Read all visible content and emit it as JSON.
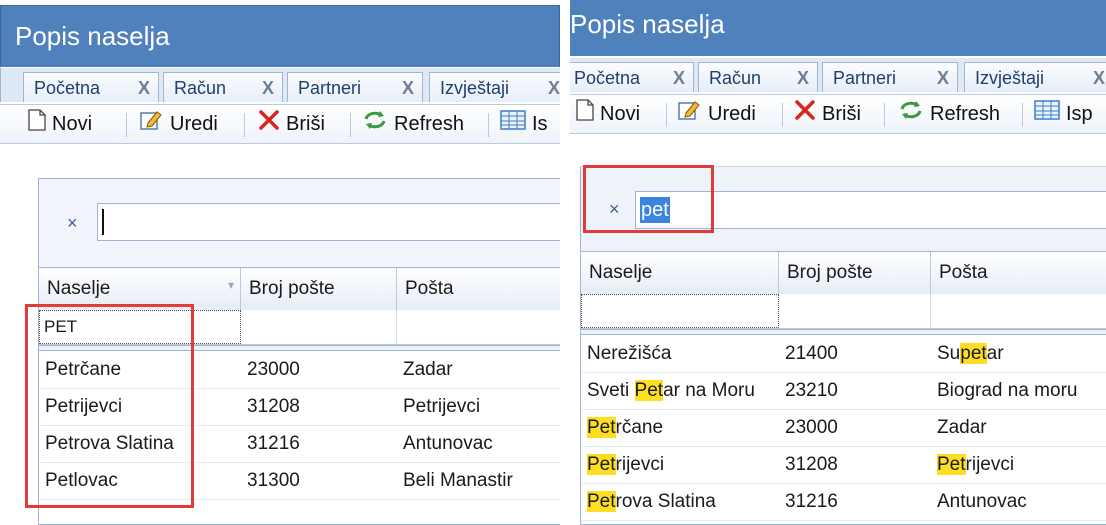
{
  "window_title": "Popis naselja",
  "tabs": [
    {
      "label": "Početna",
      "close": "X"
    },
    {
      "label": "Račun",
      "close": "X"
    },
    {
      "label": "Partneri",
      "close": "X"
    },
    {
      "label": "Izvještaji",
      "close": "X"
    }
  ],
  "toolbar": {
    "new_label": "Novi",
    "edit_label": "Uredi",
    "delete_label": "Briši",
    "refresh_label": "Refresh",
    "print_label_left": "Is",
    "print_label_right": "Isp"
  },
  "search": {
    "clear_symbol": "×",
    "left_value": "",
    "right_value": "pet"
  },
  "columns": [
    "Naselje",
    "Broj pošte",
    "Pošta"
  ],
  "left_grid": {
    "filter_value": "PET",
    "rows": [
      [
        "Petrčane",
        "23000",
        "Zadar"
      ],
      [
        "Petrijevci",
        "31208",
        "Petrijevci"
      ],
      [
        "Petrova Slatina",
        "31216",
        "Antunovac"
      ],
      [
        "Petlovac",
        "31300",
        "Beli Manastir"
      ]
    ]
  },
  "right_grid": {
    "rows": [
      {
        "c1": [
          "Nerežišća"
        ],
        "c2": "21400",
        "c3": [
          "Su",
          "pet",
          "ar"
        ]
      },
      {
        "c1": [
          "Sveti ",
          "Pet",
          "ar na Moru"
        ],
        "c2": "23210",
        "c3": [
          "Biograd na moru"
        ]
      },
      {
        "c1": [
          "",
          "Pet",
          "rčane"
        ],
        "c2": "23000",
        "c3": [
          "Zadar"
        ]
      },
      {
        "c1": [
          "",
          "Pet",
          "rijevci"
        ],
        "c2": "31208",
        "c3": [
          "",
          "Pet",
          "rijevci"
        ]
      },
      {
        "c1": [
          "",
          "Pet",
          "rova Slatina"
        ],
        "c2": "31216",
        "c3": [
          "Antunovac"
        ]
      }
    ]
  },
  "colors": {
    "title_bar": "#4f81bd",
    "highlight": "#ffde21",
    "callout": "#e03a3a"
  }
}
